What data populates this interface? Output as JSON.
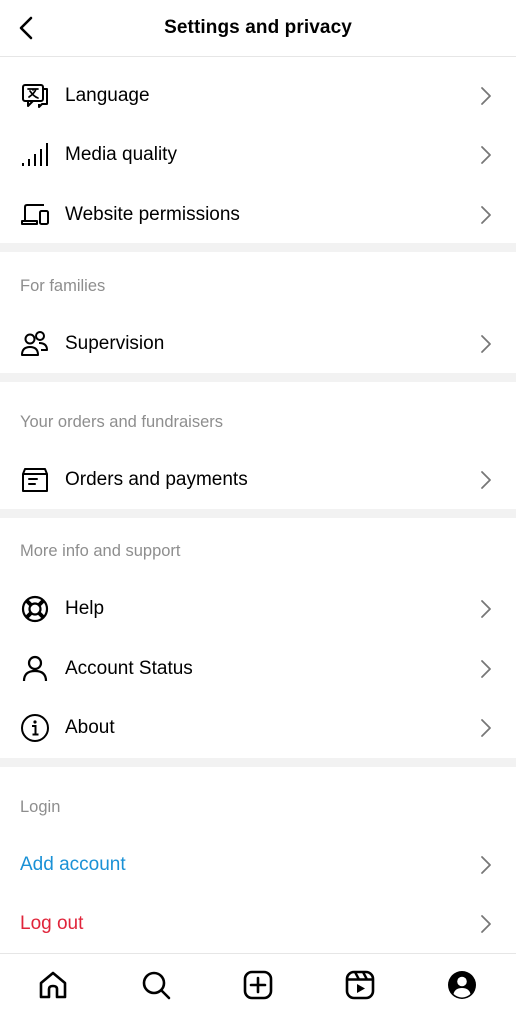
{
  "header": {
    "title": "Settings and privacy"
  },
  "rows": {
    "language": "Language",
    "media_quality": "Media quality",
    "website_permissions": "Website permissions",
    "supervision": "Supervision",
    "orders_payments": "Orders and payments",
    "help": "Help",
    "account_status": "Account Status",
    "about": "About",
    "add_account": "Add account",
    "log_out": "Log out"
  },
  "sections": {
    "families": "For families",
    "orders": "Your orders and fundraisers",
    "support": "More info and support",
    "login": "Login"
  },
  "colors": {
    "link_blue": "#1a91d6",
    "danger_red": "#e0243a",
    "section_gray": "#8e8e8e",
    "divider": "#f2f2f2"
  },
  "tabbar": {
    "icons": [
      "home-icon",
      "search-icon",
      "create-icon",
      "reels-icon",
      "profile-icon"
    ]
  }
}
